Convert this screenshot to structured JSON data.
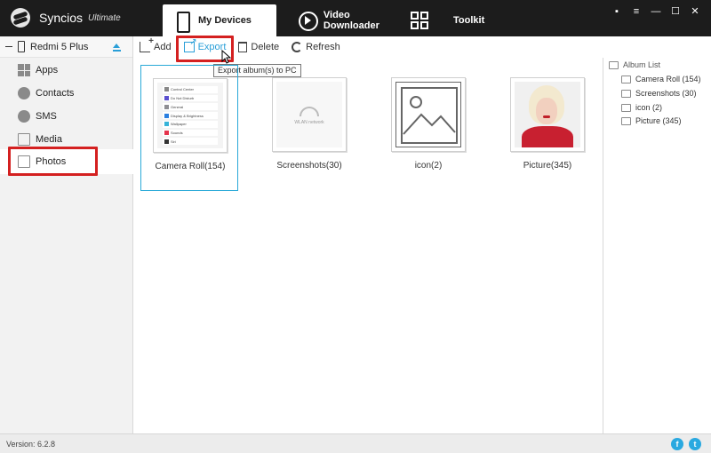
{
  "app": {
    "name": "Syncios",
    "edition": "Ultimate"
  },
  "nav": {
    "tabs": [
      {
        "label": "My Devices",
        "icon": "phone-icon",
        "active": true
      },
      {
        "label": "Video Downloader",
        "icon": "play-circle-icon",
        "active": false
      },
      {
        "label": "Toolkit",
        "icon": "grid-icon",
        "active": false
      }
    ]
  },
  "window_controls": {
    "message": "▪",
    "menu": "≡",
    "minimize": "—",
    "maximize": "☐",
    "close": "✕"
  },
  "sidebar": {
    "device": {
      "name": "Redmi 5 Plus"
    },
    "items": [
      {
        "label": "Apps",
        "icon": "apps-icon"
      },
      {
        "label": "Contacts",
        "icon": "contacts-icon"
      },
      {
        "label": "SMS",
        "icon": "sms-icon"
      },
      {
        "label": "Media",
        "icon": "media-icon"
      },
      {
        "label": "Photos",
        "icon": "photos-icon",
        "active": true
      }
    ]
  },
  "toolbar": {
    "add": "Add",
    "export": "Export",
    "delete": "Delete",
    "refresh": "Refresh",
    "export_tooltip": "Export album(s) to PC"
  },
  "albums": [
    {
      "label": "Camera Roll(154)",
      "selected": true
    },
    {
      "label": "Screenshots(30)",
      "selected": false
    },
    {
      "label": "icon(2)",
      "selected": false
    },
    {
      "label": "Picture(345)",
      "selected": false
    }
  ],
  "thumbnails": {
    "camera_roll_rows": [
      "Control Center",
      "Do Not Disturb",
      "General",
      "Display & Brightness",
      "Wallpaper",
      "Sounds",
      "Siri"
    ],
    "screenshot_text": "WLAN network"
  },
  "album_list": {
    "heading": "Album List",
    "items": [
      "Camera Roll (154)",
      "Screenshots (30)",
      "icon (2)",
      "Picture (345)"
    ]
  },
  "status": {
    "version": "Version: 6.2.8"
  },
  "colors": {
    "accent": "#2a9fd8",
    "highlight": "#d42020",
    "titlebar": "#1c1c1c"
  }
}
